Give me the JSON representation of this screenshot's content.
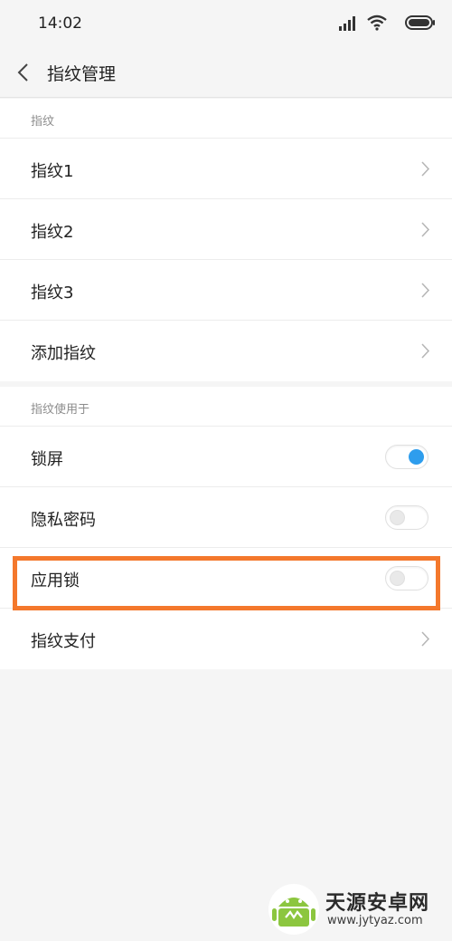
{
  "status_bar": {
    "time": "14:02",
    "icons": [
      "signal-icon",
      "wifi-icon",
      "battery-icon"
    ]
  },
  "header": {
    "title": "指纹管理",
    "back_icon": "back-icon"
  },
  "fingerprints_section": {
    "header": "指纹",
    "items": [
      {
        "label": "指纹1"
      },
      {
        "label": "指纹2"
      },
      {
        "label": "指纹3"
      },
      {
        "label": "添加指纹"
      }
    ]
  },
  "usage_section": {
    "header": "指纹使用于",
    "items": [
      {
        "label": "锁屏",
        "type": "toggle",
        "enabled": true
      },
      {
        "label": "隐私密码",
        "type": "toggle",
        "enabled": false
      },
      {
        "label": "应用锁",
        "type": "toggle",
        "enabled": false
      },
      {
        "label": "指纹支付",
        "type": "link"
      }
    ]
  },
  "colors": {
    "toggle_on": "#2e9ded",
    "highlight": "#f4782c",
    "background": "#f5f5f5"
  },
  "watermark": {
    "title": "天源安卓网",
    "url": "www.jytyaz.com"
  }
}
